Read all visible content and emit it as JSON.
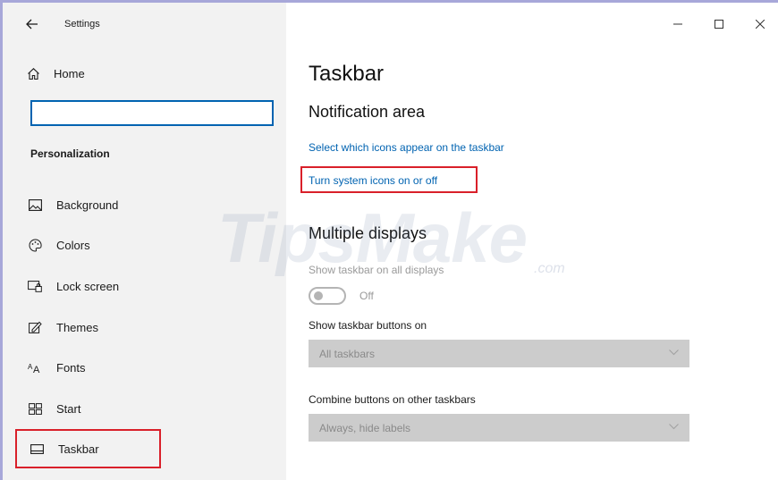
{
  "window": {
    "title": "Settings",
    "controls": {
      "minimize": "–",
      "maximize": "☐",
      "close": "✕"
    }
  },
  "sidebar": {
    "home_label": "Home",
    "search_placeholder": "",
    "section_title": "Personalization",
    "items": [
      {
        "label": "Background",
        "icon": "image-icon"
      },
      {
        "label": "Colors",
        "icon": "palette-icon"
      },
      {
        "label": "Lock screen",
        "icon": "lock-screen-icon"
      },
      {
        "label": "Themes",
        "icon": "themes-icon"
      },
      {
        "label": "Fonts",
        "icon": "fonts-icon"
      },
      {
        "label": "Start",
        "icon": "start-icon"
      },
      {
        "label": "Taskbar",
        "icon": "taskbar-icon",
        "selected": true
      }
    ]
  },
  "main": {
    "page_title": "Taskbar",
    "notification_area": {
      "heading": "Notification area",
      "link_select_icons": "Select which icons appear on the taskbar",
      "link_system_icons": "Turn system icons on or off"
    },
    "multiple_displays": {
      "heading": "Multiple displays",
      "show_all_label": "Show taskbar on all displays",
      "toggle_state": "Off",
      "buttons_on_label": "Show taskbar buttons on",
      "buttons_on_value": "All taskbars",
      "combine_label": "Combine buttons on other taskbars",
      "combine_value": "Always, hide labels"
    }
  },
  "watermark": {
    "text": "TipsMake",
    "suffix": ".com"
  },
  "colors": {
    "accent": "#0063b1",
    "highlight_box": "#d9202a",
    "sidebar_bg": "#f2f2f2"
  }
}
